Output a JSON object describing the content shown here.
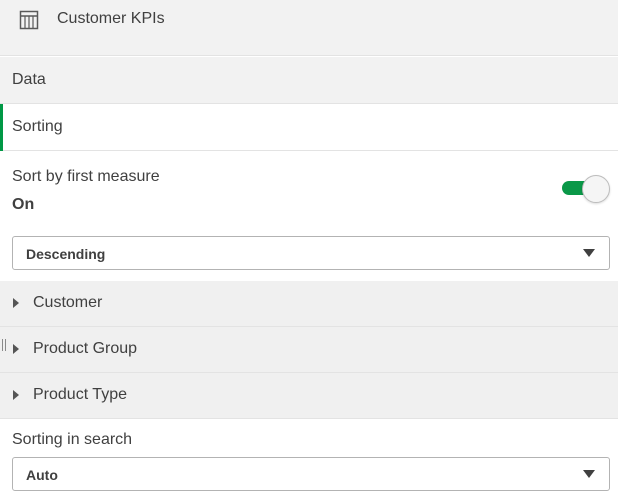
{
  "header": {
    "icon": "table-icon",
    "title": "Customer KPIs"
  },
  "sections": {
    "data_label": "Data",
    "sorting_label": "Sorting"
  },
  "sort_by_first_measure": {
    "label": "Sort by first measure",
    "state": "On",
    "enabled": true
  },
  "sort_order": {
    "selected": "Descending"
  },
  "dimensions": [
    {
      "label": "Customer"
    },
    {
      "label": "Product Group"
    },
    {
      "label": "Product Type"
    }
  ],
  "sorting_in_search": {
    "label": "Sorting in search",
    "selected": "Auto"
  },
  "colors": {
    "accent": "#009845",
    "toggle_on": "#0a9848",
    "panel_bg": "#f2f2f2",
    "text": "#404040"
  }
}
